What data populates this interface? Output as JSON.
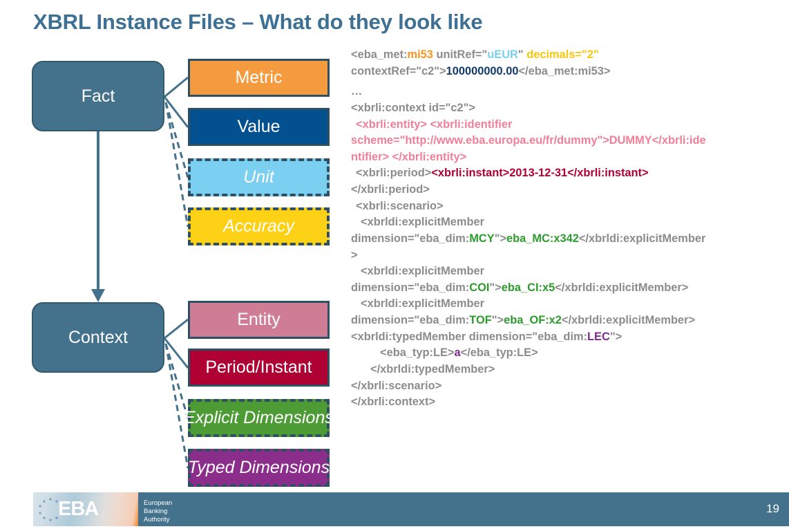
{
  "slide": {
    "title": "XBRL Instance Files – What do they look like",
    "page_number": "19"
  },
  "diagram": {
    "nodes": [
      {
        "id": "fact",
        "label": "Fact"
      },
      {
        "id": "context",
        "label": "Context"
      }
    ],
    "fact_attributes": [
      {
        "id": "metric",
        "label": "Metric",
        "color": "#F59B3F",
        "style": "solid"
      },
      {
        "id": "value",
        "label": "Value",
        "color": "#02508F",
        "style": "solid"
      },
      {
        "id": "unit",
        "label": "Unit",
        "color": "#7BD0F2",
        "style": "dashed"
      },
      {
        "id": "accuracy",
        "label": "Accuracy",
        "color": "#FCD116",
        "style": "dashed"
      }
    ],
    "context_attributes": [
      {
        "id": "entity",
        "label": "Entity",
        "color": "#CE7D95",
        "style": "solid"
      },
      {
        "id": "period",
        "label": "Period/Instant",
        "color": "#AE0033",
        "style": "solid"
      },
      {
        "id": "explicit",
        "label": "Explicit Dimensions",
        "color": "#4D9B35",
        "style": "dashed"
      },
      {
        "id": "typed",
        "label": "Typed Dimensions",
        "color": "#8B2E8B",
        "style": "dashed"
      }
    ],
    "node_fill": "#44718C",
    "connector_color": "#44718C"
  },
  "xml": {
    "l1_a": "<eba_met:",
    "l1_b": "mi53",
    "l1_c": " unitRef=\"",
    "l1_d": "uEUR",
    "l1_e": "\" ",
    "l1_f": "decimals=\"2\"",
    "l2_a": "contextRef=\"c2\">",
    "l2_b": "100000000.00",
    "l2_c": "</eba_met:mi53>",
    "l3": "…",
    "l4": "<xbrli:context id=\"c2\">",
    "l5": "<xbrli:entity> <xbrli:identifier",
    "l6": "scheme=\"http://www.eba.europa.eu/fr/dummy\">DUMMY</xbrli:ide",
    "l7": "ntifier>  </xbrli:entity>",
    "l8_a": "<xbrli:period>",
    "l8_b": "<xbrli:instant>2013-12-31</xbrli:instant>",
    "l9": "</xbrli:period>",
    "l10": "<xbrli:scenario>",
    "l11": "<xbrldi:explicitMember",
    "l12_a": "dimension=\"eba_dim:",
    "l12_b": "MCY",
    "l12_c": "\">",
    "l12_d": "eba_MC:x342",
    "l12_e": "</xbrldi:explicitMember",
    "l13": ">",
    "l14": "<xbrldi:explicitMember",
    "l15_a": "dimension=\"eba_dim:",
    "l15_b": "COI",
    "l15_c": "\">",
    "l15_d": "eba_CI:x5",
    "l15_e": "</xbrldi:explicitMember>",
    "l16": "<xbrldi:explicitMember",
    "l17_a": "dimension=\"eba_dim:",
    "l17_b": "TOF",
    "l17_c": "\">",
    "l17_d": "eba_OF:x2",
    "l17_e": "</xbrldi:explicitMember>",
    "l18_a": "<xbrldi:typedMember dimension=\"eba_dim:",
    "l18_b": "LEC",
    "l18_c": "\">",
    "l19_a": "<eba_typ:LE>",
    "l19_b": "a",
    "l19_c": "</eba_typ:LE>",
    "l20": "</xbrldi:typedMember>",
    "l21": "</xbrli:scenario>",
    "l22": "</xbrli:context>"
  },
  "footer": {
    "logo_word": "EBA",
    "org_line1": "European",
    "org_line2": "Banking",
    "org_line3": "Authority"
  }
}
